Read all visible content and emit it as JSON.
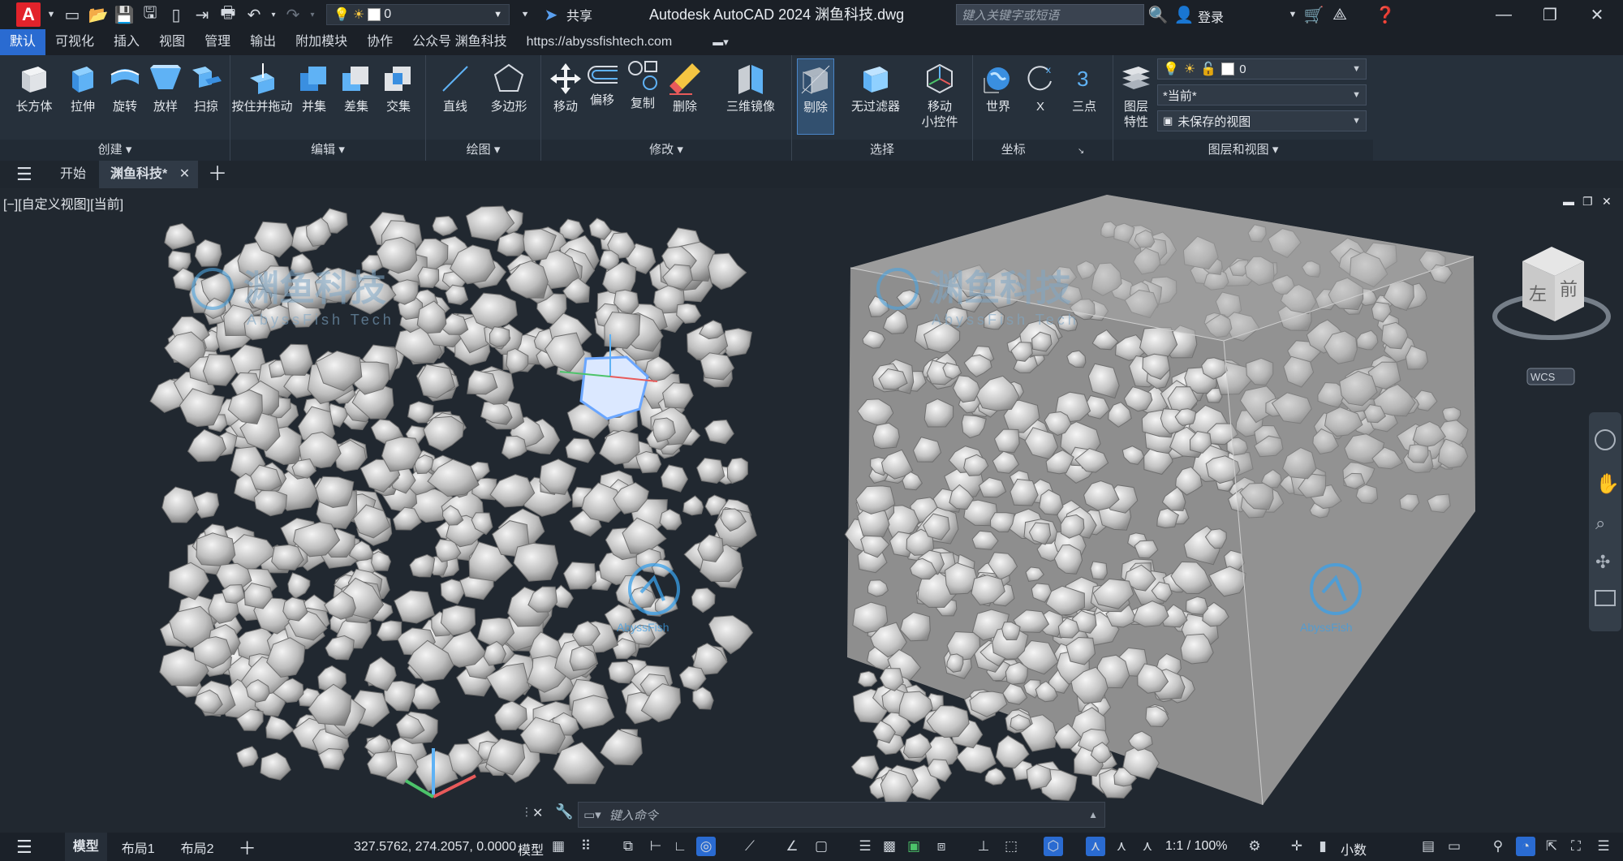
{
  "app": {
    "title": "Autodesk AutoCAD 2024    渊鱼科技.dwg",
    "logo": "A",
    "share_label": "共享"
  },
  "quick_access": {
    "layer_value": "0"
  },
  "search": {
    "placeholder": "键入关键字或短语"
  },
  "account": {
    "login_label": "登录"
  },
  "menu": {
    "items": [
      "默认",
      "可视化",
      "插入",
      "视图",
      "管理",
      "输出",
      "附加模块",
      "协作",
      "公众号 渊鱼科技",
      "https://abyssfishtech.com"
    ]
  },
  "ribbon": {
    "create": {
      "title": "创建",
      "tools": [
        "长方体",
        "拉伸",
        "旋转",
        "放样",
        "扫掠"
      ]
    },
    "edit": {
      "title": "编辑",
      "tools": [
        "按住并拖动",
        "并集",
        "差集",
        "交集"
      ]
    },
    "draw": {
      "title": "绘图",
      "tools": [
        "直线",
        "多边形"
      ]
    },
    "modify": {
      "title": "修改",
      "tools": [
        "移动",
        "偏移",
        "复制",
        "删除",
        "三维镜像"
      ]
    },
    "select": {
      "title": "选择",
      "tools": [
        "剔除",
        "无过滤器",
        "移动\n小控件"
      ]
    },
    "coords": {
      "title": "坐标",
      "tools": [
        "世界",
        "X",
        "三点"
      ]
    },
    "layers": {
      "title": "图层和视图",
      "layer_props": "图层\n特性",
      "layer_value": "0",
      "visual_style": "*当前*",
      "named_view": "未保存的视图"
    }
  },
  "tabs": {
    "start": "开始",
    "doc": "渊鱼科技*"
  },
  "viewport": {
    "label": "[−][自定义视图][当前]",
    "watermark_cn": "渊鱼科技",
    "watermark_en": "AbyssFish Tech",
    "watermark_small": "AbyssFish",
    "viewcube_left": "左",
    "viewcube_front": "前",
    "wcs_label": "WCS"
  },
  "command": {
    "placeholder": "键入命令"
  },
  "status": {
    "coords": "327.5762, 274.2057, 0.0000",
    "model_label": "模型",
    "tabs": [
      "模型",
      "布局1",
      "布局2"
    ],
    "scale": "1:1 / 100%",
    "units": "小数"
  },
  "colors": {
    "accent": "#2a6bd1",
    "logo": "#e2232b",
    "bg": "#212830",
    "ribbon": "#26303b"
  }
}
